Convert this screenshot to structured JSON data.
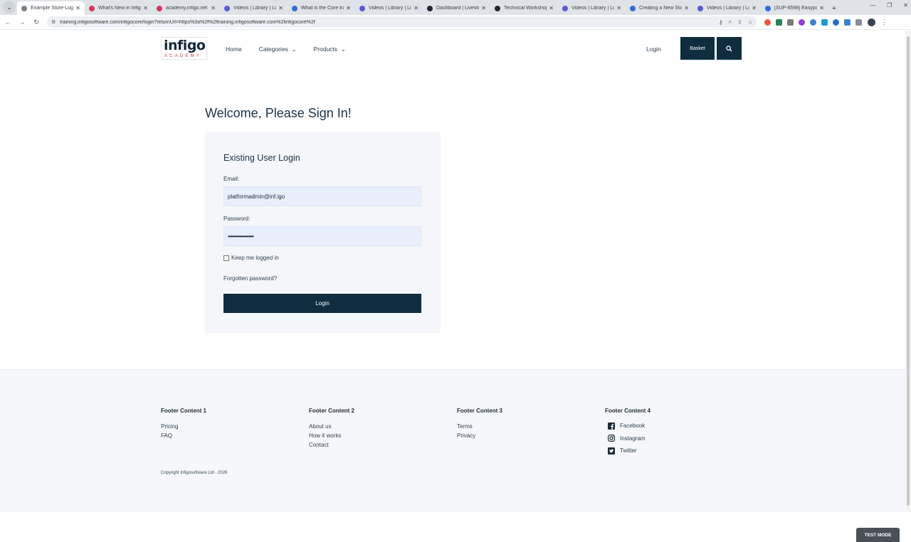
{
  "browser": {
    "tabs": [
      {
        "label": "Example Store-Login",
        "active": true,
        "color": "#7a7f87"
      },
      {
        "label": "What's New in Infigo?",
        "active": false,
        "color": "#d23a5a"
      },
      {
        "label": "academy.infigo.net",
        "active": false,
        "color": "#d23a5a"
      },
      {
        "label": "Videos | Library | Loom",
        "active": false,
        "color": "#5b5bd6"
      },
      {
        "label": "What is the Core trainin",
        "active": false,
        "color": "#2f6fd6"
      },
      {
        "label": "Videos | Library | Loom",
        "active": false,
        "color": "#5b5bd6"
      },
      {
        "label": "Dashboard | Livestorm",
        "active": false,
        "color": "#1f2a33"
      },
      {
        "label": "Technical Workshop | L",
        "active": false,
        "color": "#1f2a33"
      },
      {
        "label": "Videos | Library | Loom",
        "active": false,
        "color": "#5b5bd6"
      },
      {
        "label": "Creating a New Store",
        "active": false,
        "color": "#2f6fd6"
      },
      {
        "label": "Videos | Library | Loom",
        "active": false,
        "color": "#5b5bd6"
      },
      {
        "label": "[SUP-6598] Easypost is",
        "active": false,
        "color": "#2f6fd6"
      }
    ],
    "url": "training.infigosoftware.com/infigocore/login?returnUrl=https%3a%2f%2ftraining.infigosoftware.com%2finfigocore%2f"
  },
  "header": {
    "logo_word": "infigo",
    "logo_sub": "ACADEMY",
    "nav": [
      {
        "label": "Home",
        "dropdown": false
      },
      {
        "label": "Categories",
        "dropdown": true
      },
      {
        "label": "Products",
        "dropdown": true
      }
    ],
    "login_label": "Login",
    "basket_label": "Basket"
  },
  "main": {
    "title": "Welcome, Please Sign In!",
    "box_title": "Existing User Login",
    "email_label": "Email:",
    "email_value": "platformadmin@inf.igo",
    "password_label": "Password:",
    "password_value": "••••••••••••••••••••",
    "remember_label": "Keep me logged in",
    "remember_checked": false,
    "forgot_label": "Forgotten password?",
    "login_button": "Login"
  },
  "footer": {
    "columns": [
      {
        "heading": "Footer Content 1",
        "links": [
          "Pricing",
          "FAQ"
        ]
      },
      {
        "heading": "Footer Content 2",
        "links": [
          "About us",
          "How it works",
          "Contact"
        ]
      },
      {
        "heading": "Footer Content 3",
        "links": [
          "Terms",
          "Privacy"
        ]
      }
    ],
    "social": {
      "heading": "Footer Content 4",
      "links": [
        {
          "label": "Facebook",
          "icon": "facebook-icon"
        },
        {
          "label": "Instagram",
          "icon": "instagram-icon"
        },
        {
          "label": "Twitter",
          "icon": "twitter-icon"
        }
      ]
    },
    "copyright": "Copyright Infigosoftware Ltd - 2026",
    "test_mode": "TEST MODE"
  },
  "colors": {
    "brand_dark": "#0f2d3f",
    "logo_red": "#c8323c",
    "input_bg": "#e8eefc"
  }
}
